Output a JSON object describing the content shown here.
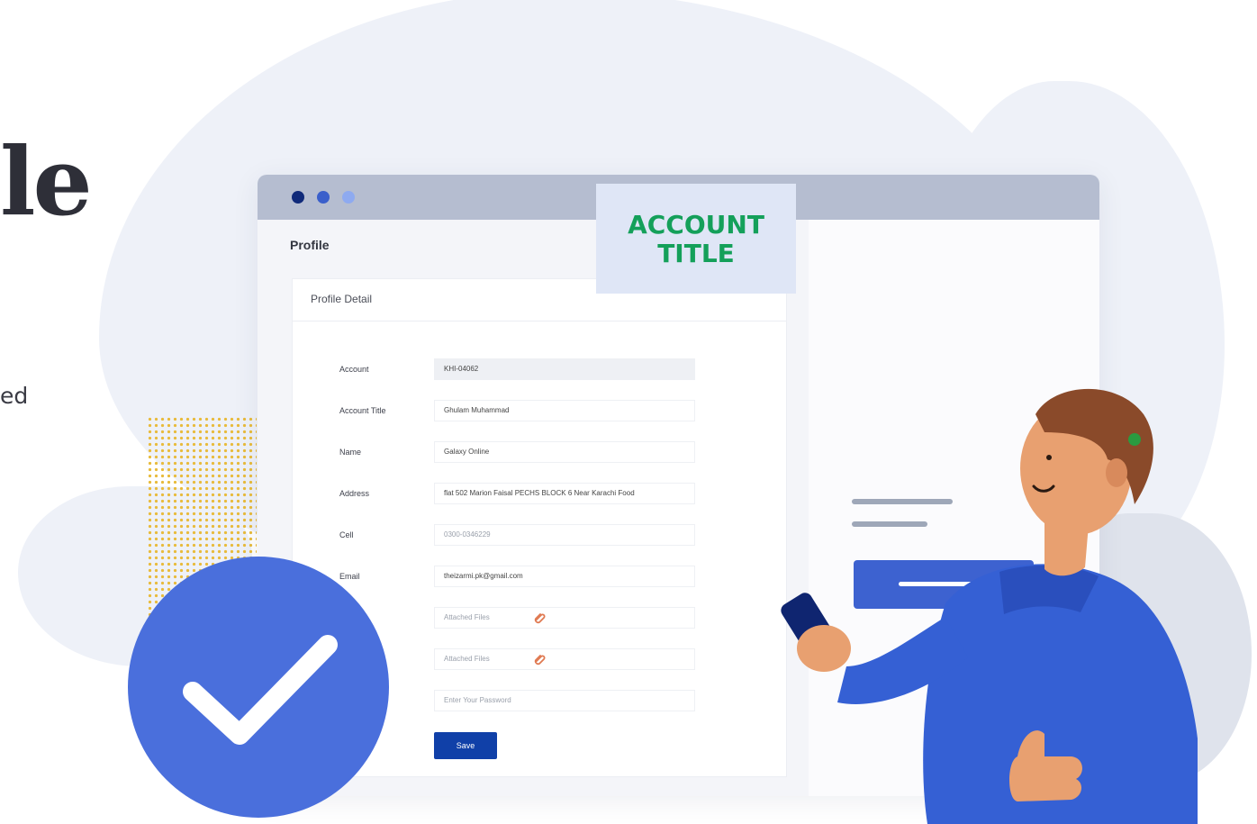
{
  "hero": {
    "headline_fragment": "le",
    "sub_fragment": "ed"
  },
  "window": {
    "page_title": "Profile",
    "card_title": "Profile Detail",
    "fields": [
      {
        "label": "Account",
        "value": "KHI-04062"
      },
      {
        "label": "Account Title",
        "value": "Ghulam Muhammad"
      },
      {
        "label": "Name",
        "value": "Galaxy Online"
      },
      {
        "label": "Address",
        "value": "flat 502 Marion Faisal PECHS BLOCK 6 Near Karachi Food"
      },
      {
        "label": "Cell",
        "value": "0300-0346229"
      },
      {
        "label": "Email",
        "value": "theizarmi.pk@gmail.com"
      },
      {
        "label": "",
        "placeholder": "Attached Files"
      },
      {
        "label": "",
        "placeholder": "Attached Files"
      },
      {
        "label": "",
        "placeholder": "Enter Your Password"
      }
    ],
    "save_label": "Save"
  },
  "side": {
    "account_title_line1": "ACCOUNT",
    "account_title_line2": "TITLE"
  },
  "colors": {
    "titlebar": "#b5bdd0",
    "accent_blue": "#1040a8",
    "account_green": "#14a05a",
    "check_circle": "#4a6fdc"
  },
  "icons": [
    "paperclip-icon",
    "checkmark-icon",
    "window-dot-icon"
  ]
}
